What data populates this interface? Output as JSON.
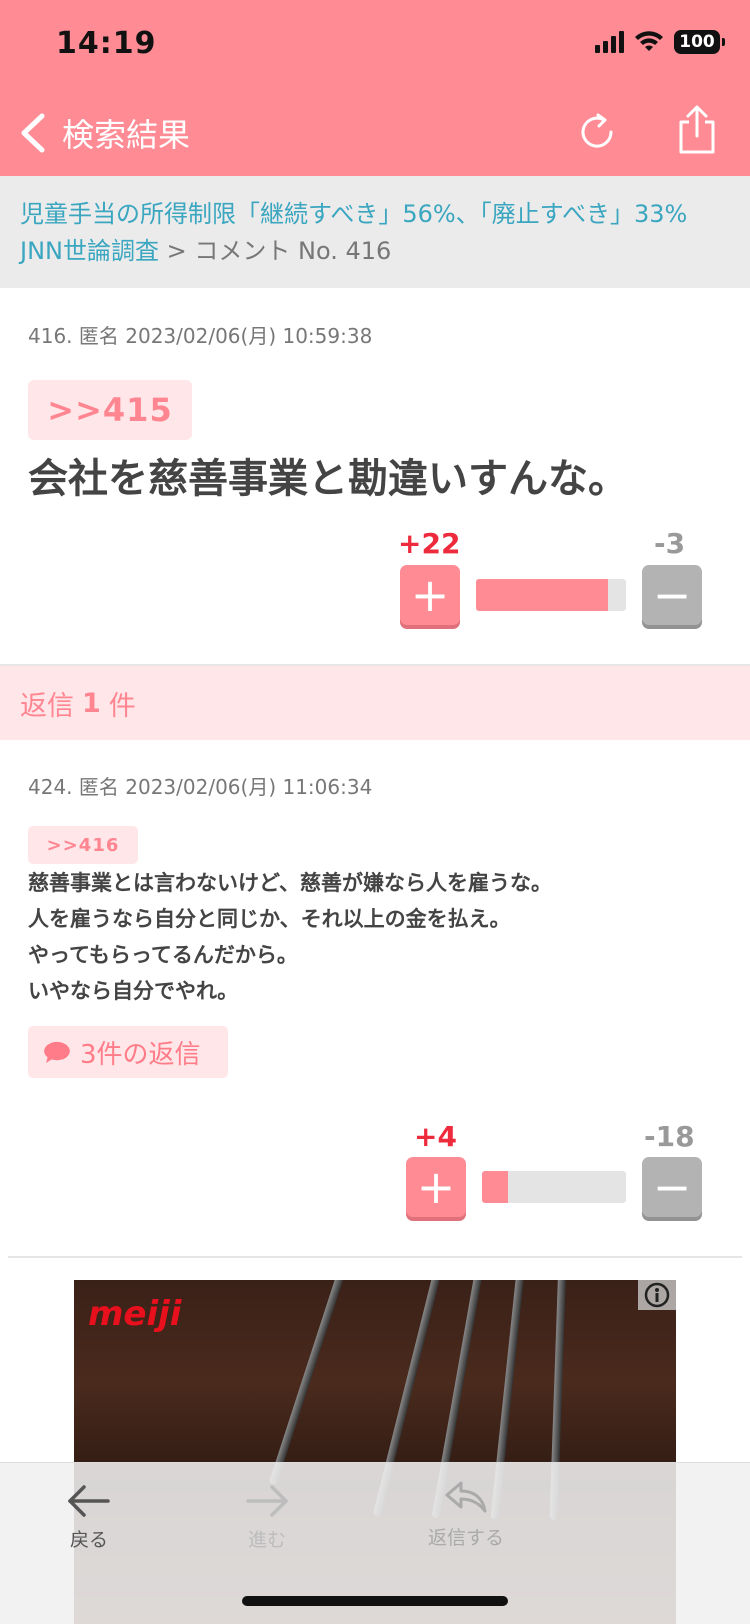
{
  "status_bar": {
    "time": "14:19",
    "battery": "100"
  },
  "nav": {
    "back_title": "検索結果"
  },
  "breadcrumb": {
    "article_title": "児童手当の所得制限「継続すべき」56%、「廃止すべき」33%　JNN世論調査",
    "separator": ">",
    "current": "コメント No. 416"
  },
  "comment": {
    "meta": "416. 匿名 2023/02/06(月) 10:59:38",
    "anchor": ">>415",
    "text": "会社を慈善事業と勘違いすんな。",
    "plus": "+22",
    "minus": "-3",
    "plus_ratio": 0.88
  },
  "replies_header": {
    "prefix": "返信",
    "count": "1",
    "suffix": "件"
  },
  "reply": {
    "meta": "424. 匿名 2023/02/06(月) 11:06:34",
    "anchor": ">>416",
    "lines": [
      "慈善事業とは言わないけど、慈善が嫌なら人を雇うな。",
      "人を雇うなら自分と同じか、それ以上の金を払え。",
      "やってもらってるんだから。",
      "いやなら自分でやれ。"
    ],
    "replies_button": "3件の返信",
    "plus": "+4",
    "minus": "-18",
    "plus_ratio": 0.18
  },
  "ad": {
    "brand": "meiji"
  },
  "toolbar": {
    "back": "戻る",
    "forward": "進む",
    "reply": "返信する"
  },
  "colors": {
    "accent": "#ff8c95",
    "link": "#3aa6c0",
    "plus": "#ee2a3d"
  }
}
